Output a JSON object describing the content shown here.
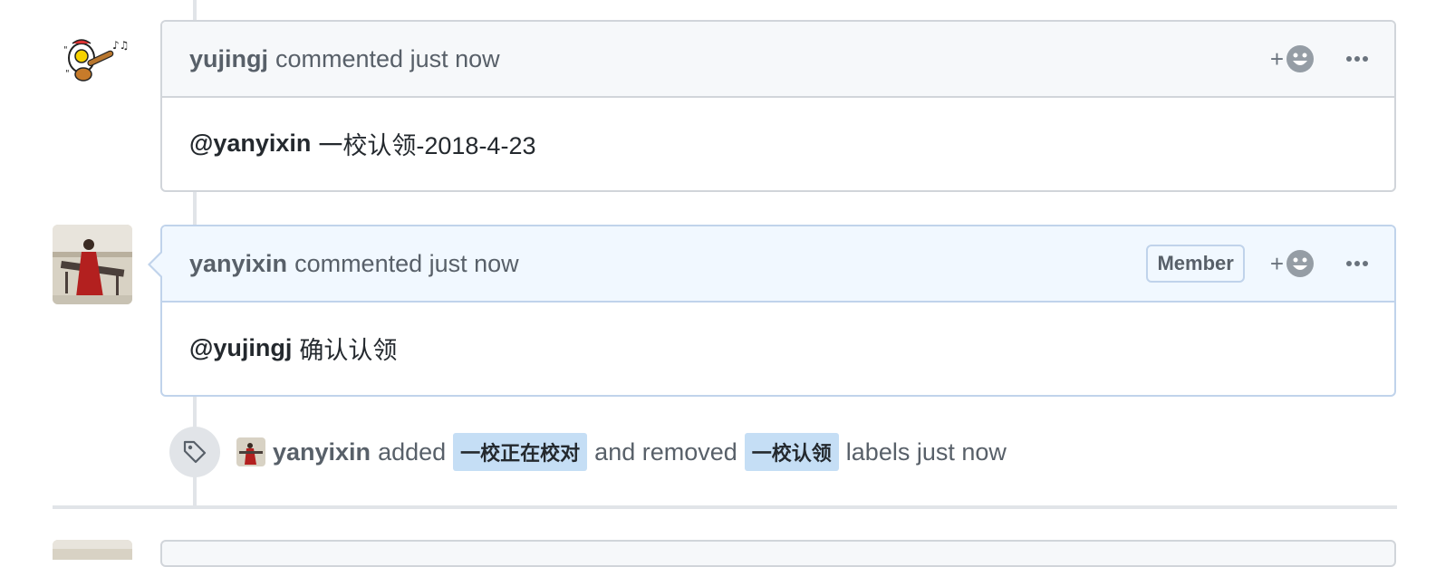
{
  "comments": [
    {
      "author": "yujingj",
      "meta": "commented just now",
      "mention": "@yanyixin",
      "body": "一校认领-2018-4-23"
    },
    {
      "author": "yanyixin",
      "meta": "commented just now",
      "role_badge": "Member",
      "mention": "@yujingj",
      "body": "确认认领"
    }
  ],
  "event": {
    "actor": "yanyixin",
    "added_text": "added",
    "added_label": "一校正在校对",
    "removed_text": "and removed",
    "removed_label": "一校认领",
    "suffix": "labels just now"
  },
  "icons": {
    "add_reaction": "smiley-icon",
    "more": "kebab-horizontal-icon",
    "event": "tag-icon"
  },
  "colors": {
    "label_bg": "#c5def5",
    "member_header_bg": "#f1f8ff",
    "border": "#d1d5da"
  }
}
